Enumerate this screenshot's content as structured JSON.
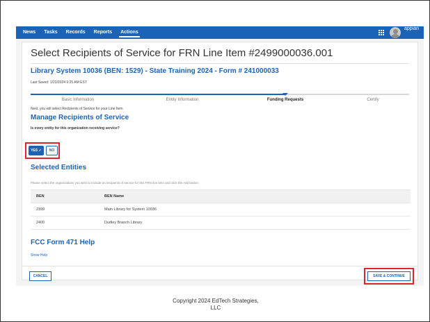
{
  "nav": {
    "tabs": [
      "News",
      "Tasks",
      "Records",
      "Reports",
      "Actions"
    ],
    "active_tab": "Actions",
    "brand": "appian",
    "grid_icon": "app-grid-icon",
    "avatar_icon": "user-avatar-icon",
    "color": "#1c62b5"
  },
  "page": {
    "title": "Select Recipients of Service for FRN Line Item #2499000036.001",
    "subtitle": "Library System 10036 (BEN: 1529) - State Training 2024 - Form # 241000033",
    "last_saved": "Last Saved: 1/22/2024 9:25 AM EST"
  },
  "stepper": {
    "steps": [
      "Basic Information",
      "Entity Information",
      "Funding Requests",
      "Certify"
    ],
    "current": "Funding Requests"
  },
  "instruction": "Next, you will select Recipients of Service for your Line Item",
  "manage": {
    "heading": "Manage Recipients of Service",
    "question": "Is every entity for this organization receiving service?",
    "yes_label": "YES ✓",
    "no_label": "NO",
    "selected": "YES"
  },
  "selected_entities": {
    "heading": "Selected Entities",
    "helper": "Please select the organizations you wish to include as recipients of service for this FRN line item and click the Add button.",
    "columns": [
      "BEN",
      "BEN Name"
    ],
    "rows": [
      [
        "2399",
        "Main Library for System 10036"
      ],
      [
        "2400",
        "Dudley Branch Library"
      ]
    ]
  },
  "help": {
    "heading": "FCC Form 471 Help",
    "link": "Show Help"
  },
  "actions": {
    "cancel": "CANCEL",
    "save": "SAVE & CONTINUE"
  },
  "footer": {
    "copyright_line1": "Copyright 2024 EdTech Strategies,",
    "copyright_line2": "LLC"
  },
  "colors": {
    "accent": "#1c62b5",
    "highlight": "#d9252b"
  }
}
